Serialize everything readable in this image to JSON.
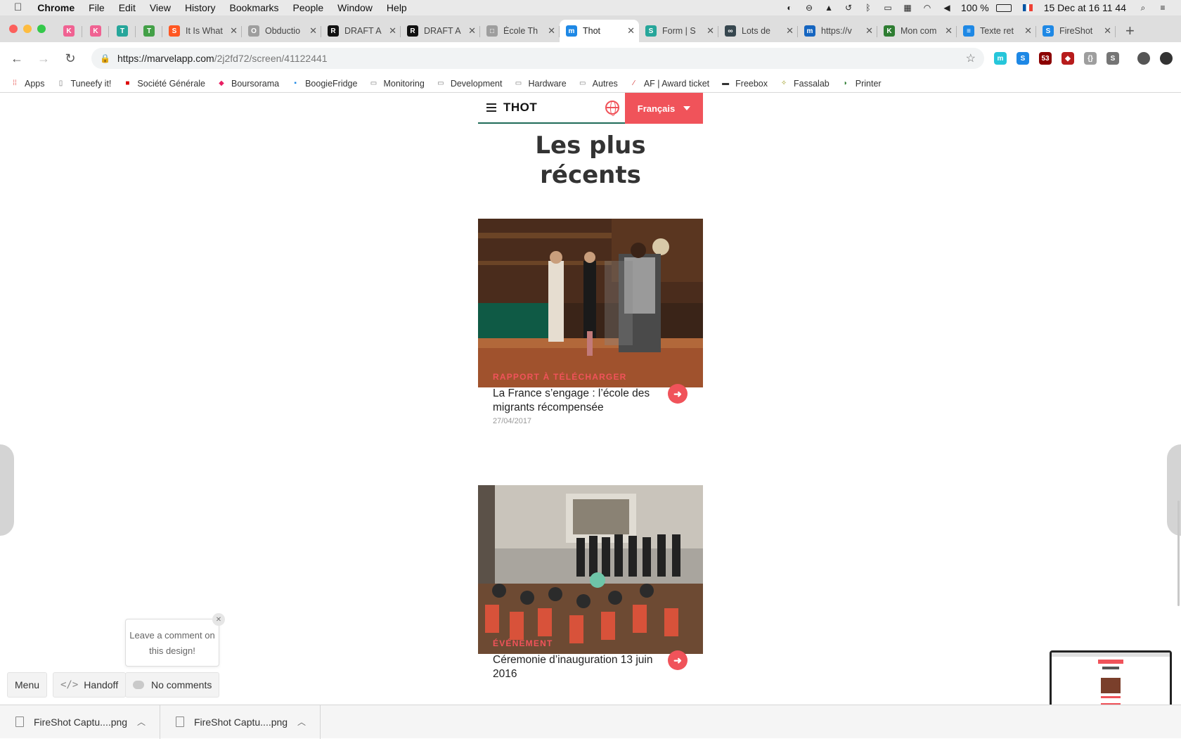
{
  "menubar": {
    "app_name": "Chrome",
    "items": [
      "File",
      "Edit",
      "View",
      "History",
      "Bookmarks",
      "People",
      "Window",
      "Help"
    ],
    "battery": "100 %",
    "datetime": "15 Dec at  16 11 44"
  },
  "tabs": [
    {
      "title": "",
      "favicon": "K",
      "color": "#f06292",
      "pinned": true
    },
    {
      "title": "",
      "favicon": "K",
      "color": "#f06292",
      "pinned": true
    },
    {
      "title": "",
      "favicon": "T",
      "color": "#26a69a",
      "pinned": true
    },
    {
      "title": "",
      "favicon": "T",
      "color": "#43a047",
      "pinned": true
    },
    {
      "title": "It Is What",
      "favicon": "S",
      "color": "#ff5722"
    },
    {
      "title": "Obductio",
      "favicon": "O",
      "color": "#9e9e9e"
    },
    {
      "title": "DRAFT A",
      "favicon": "R",
      "color": "#111111"
    },
    {
      "title": "DRAFT A",
      "favicon": "R",
      "color": "#111111"
    },
    {
      "title": "École Th",
      "favicon": "□",
      "color": "#9e9e9e"
    },
    {
      "title": "Thot",
      "favicon": "m",
      "color": "#1e88e5",
      "active": true
    },
    {
      "title": "Form | S",
      "favicon": "S",
      "color": "#26a69a"
    },
    {
      "title": "Lots de",
      "favicon": "∞",
      "color": "#37474f"
    },
    {
      "title": "https://v",
      "favicon": "m",
      "color": "#1565c0"
    },
    {
      "title": "Mon com",
      "favicon": "K",
      "color": "#2e7d32"
    },
    {
      "title": "Texte ret",
      "favicon": "≡",
      "color": "#1e88e5"
    },
    {
      "title": "FireShot",
      "favicon": "S",
      "color": "#1e88e5"
    }
  ],
  "address_bar": {
    "host": "https://marvelapp.com",
    "path": "/2j2fd72/screen/41122441"
  },
  "extensions": [
    {
      "icon": "m",
      "color": "#26c6da"
    },
    {
      "icon": "S",
      "color": "#1e88e5"
    },
    {
      "icon": "53",
      "color": "#8b0000"
    },
    {
      "icon": "◆",
      "color": "#b71c1c"
    },
    {
      "icon": "{}",
      "color": "#9e9e9e"
    },
    {
      "icon": "S",
      "color": "#757575"
    }
  ],
  "bookmarks": [
    {
      "label": "Apps",
      "icon": "apps-grid-icon"
    },
    {
      "label": "Tuneefy it!",
      "icon": "page-icon"
    },
    {
      "label": "Société Générale",
      "icon": "sg-icon"
    },
    {
      "label": "Boursorama",
      "icon": "boursorama-icon"
    },
    {
      "label": "BoogieFridge",
      "icon": "dsm-icon"
    },
    {
      "label": "Monitoring",
      "icon": "folder-icon"
    },
    {
      "label": "Development",
      "icon": "folder-icon"
    },
    {
      "label": "Hardware",
      "icon": "folder-icon"
    },
    {
      "label": "Autres",
      "icon": "folder-icon"
    },
    {
      "label": "AF | Award ticket",
      "icon": "af-icon"
    },
    {
      "label": "Freebox",
      "icon": "freebox-icon"
    },
    {
      "label": "Fassalab",
      "icon": "fassalab-icon"
    },
    {
      "label": "Printer",
      "icon": "printer-icon"
    }
  ],
  "site": {
    "logo": "THOT",
    "language": "Français",
    "section_title_line1": "Les plus",
    "section_title_line2": "récents",
    "cards": [
      {
        "category": "RAPPORT À TÉLÉCHARGER",
        "title": "La France s’engage : l’école des migrants récompensée",
        "date": "27/04/2017"
      },
      {
        "category": "ÉVÉNEMENT",
        "title": "Céremonie d’inauguration 13 juin 2016",
        "date": ""
      }
    ]
  },
  "marvel": {
    "menu_label": "Menu",
    "handoff_label": "Handoff",
    "comments_label": "No comments",
    "tooltip": "Leave a comment on this design!"
  },
  "downloads": [
    {
      "filename": "FireShot Captu....png"
    },
    {
      "filename": "FireShot Captu....png"
    }
  ]
}
